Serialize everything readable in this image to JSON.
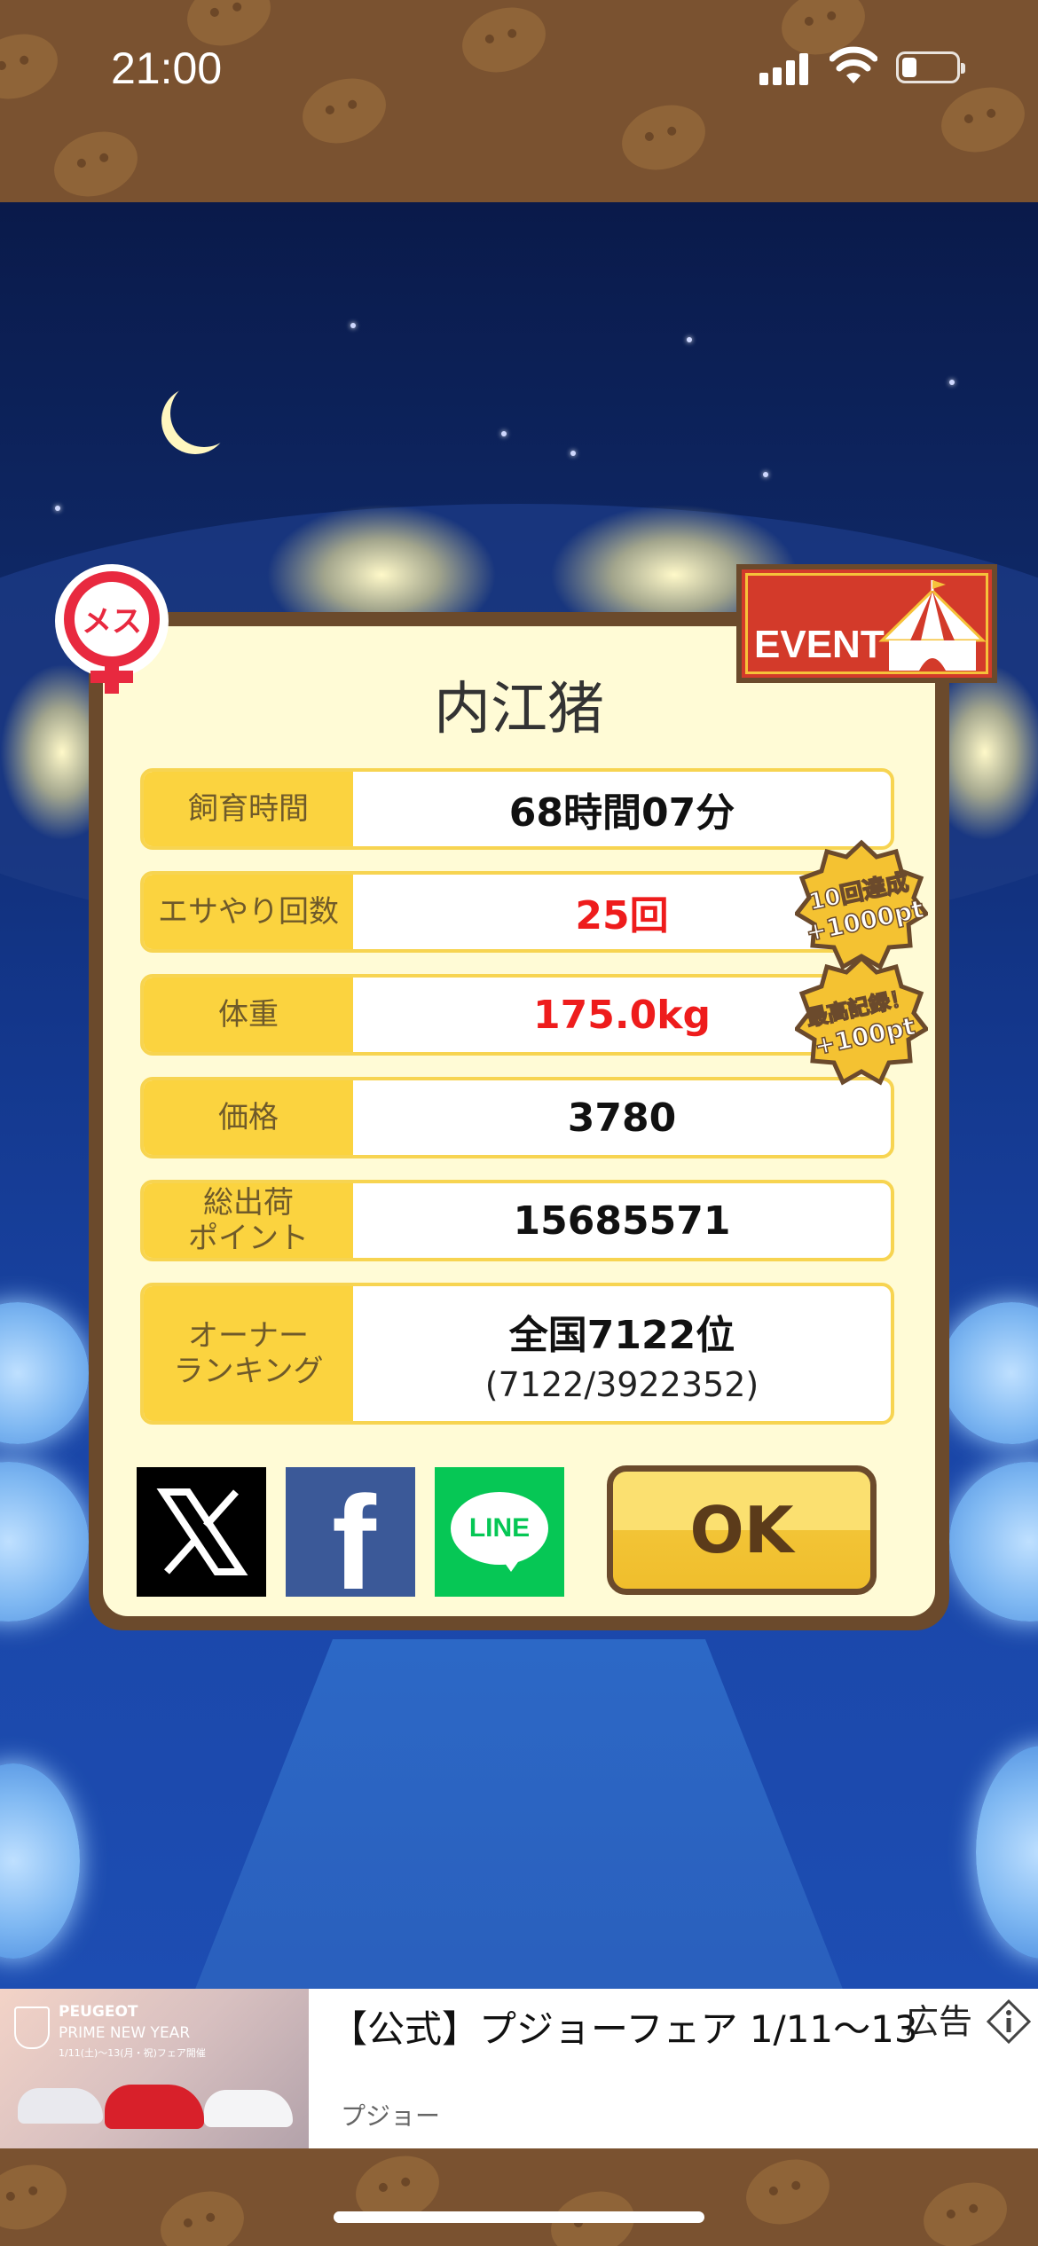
{
  "status_bar": {
    "time": "21:00"
  },
  "dialog": {
    "gender_badge": "メス",
    "event_badge": "EVENT",
    "title": "内江猪",
    "rows": [
      {
        "label": "飼育時間",
        "value": "68時間07分"
      },
      {
        "label": "エサやり回数",
        "value": "25回"
      },
      {
        "label": "体重",
        "value": "175.0kg"
      },
      {
        "label": "価格",
        "value": "3780"
      },
      {
        "label": "総出荷\nポイント",
        "value": "15685571"
      },
      {
        "label": "オーナー\nランキング",
        "value": "全国7122位",
        "sub": "(7122/3922352)"
      }
    ],
    "bonus_badges": [
      {
        "line1": "10回達成",
        "line2": "+1000pt"
      },
      {
        "line1": "最高記録！",
        "line2": "+100pt"
      }
    ],
    "share": {
      "x_label": "X",
      "facebook_label": "f",
      "line_label": "LINE"
    },
    "ok_label": "OK"
  },
  "ad": {
    "image_text_line1": "PEUGEOT",
    "image_text_line2": "PRIME NEW YEAR",
    "image_text_line3": "1/11(土)〜13(月・祝)フェア開催",
    "title": "【公式】プジョーフェア 1/11〜13",
    "label": "広告",
    "sponsor": "プジョー"
  },
  "colors": {
    "brown": "#6b4a2c",
    "label_yellow": "#fbd33f",
    "value_red": "#ee1c1c",
    "night_blue": "#13368a"
  }
}
